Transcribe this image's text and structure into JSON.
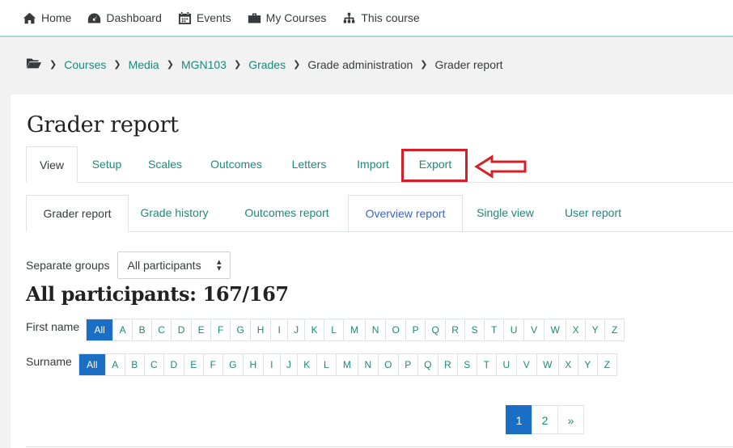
{
  "topnav": {
    "items": [
      {
        "label": "Home",
        "icon": "home-icon"
      },
      {
        "label": "Dashboard",
        "icon": "dashboard-icon"
      },
      {
        "label": "Events",
        "icon": "calendar-icon"
      },
      {
        "label": "My Courses",
        "icon": "briefcase-icon"
      },
      {
        "label": "This course",
        "icon": "sitemap-icon"
      }
    ]
  },
  "breadcrumb": {
    "items": [
      "Courses",
      "Media",
      "MGN103",
      "Grades",
      "Grade administration",
      "Grader report"
    ]
  },
  "page": {
    "title": "Grader report"
  },
  "tabs": [
    "View",
    "Setup",
    "Scales",
    "Outcomes",
    "Letters",
    "Import",
    "Export"
  ],
  "subtabs": [
    "Grader report",
    "Grade history",
    "Outcomes report",
    "Overview report",
    "Single view",
    "User report"
  ],
  "groups": {
    "label": "Separate groups",
    "selected": "All participants"
  },
  "participants": {
    "heading": "All participants: 167/167"
  },
  "firstname": {
    "label": "First name",
    "letters": [
      "All",
      "A",
      "B",
      "C",
      "D",
      "E",
      "F",
      "G",
      "H",
      "I",
      "J",
      "K",
      "L",
      "M",
      "N",
      "O",
      "P",
      "Q",
      "R",
      "S",
      "T",
      "U",
      "V",
      "W",
      "X",
      "Y",
      "Z"
    ]
  },
  "surname": {
    "label": "Surname",
    "letters": [
      "All",
      "A",
      "B",
      "C",
      "D",
      "E",
      "F",
      "G",
      "H",
      "I",
      "J",
      "K",
      "L",
      "M",
      "N",
      "O",
      "P",
      "Q",
      "R",
      "S",
      "T",
      "U",
      "V",
      "W",
      "X",
      "Y",
      "Z"
    ]
  },
  "pagination": {
    "pages": [
      "1",
      "2",
      "»"
    ]
  },
  "colors": {
    "link": "#1a8a7a",
    "active_blue": "#1a6fc4",
    "highlight_red": "#d61f26"
  }
}
